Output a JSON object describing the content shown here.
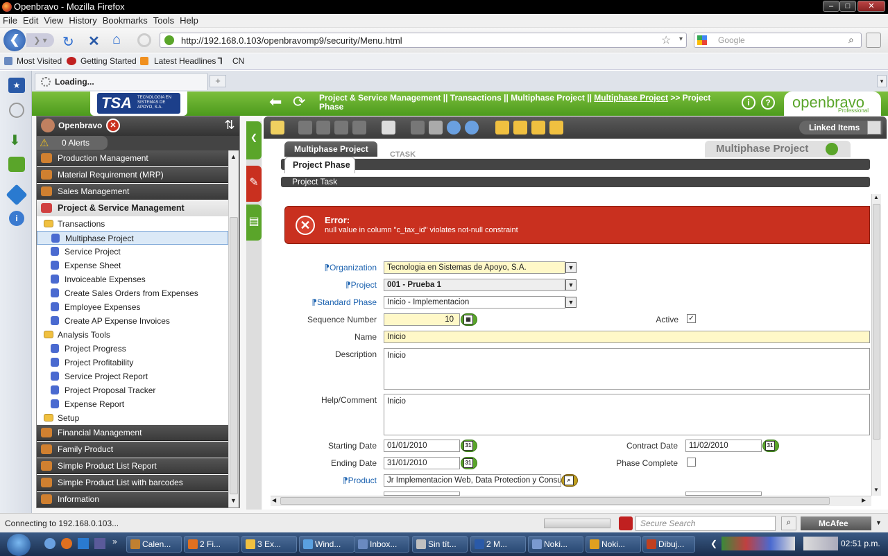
{
  "window": {
    "title": "Openbravo - Mozilla Firefox"
  },
  "menubar": [
    "File",
    "Edit",
    "View",
    "History",
    "Bookmarks",
    "Tools",
    "Help"
  ],
  "nav": {
    "url": "http://192.168.0.103/openbravomp9/security/Menu.html",
    "search_placeholder": "Google"
  },
  "bookmarks": [
    "Most Visited",
    "Getting Started",
    "Latest Headlines",
    "CN"
  ],
  "tab": {
    "label": "Loading..."
  },
  "app": {
    "breadcrumb_line1": "Project & Service Management || Transactions || Multiphase Project ||",
    "breadcrumb_link": "Multiphase Project",
    "breadcrumb_tail": ">> Project",
    "breadcrumb_line2": "Phase",
    "brand": "openbravo",
    "brand_sub": "Professional",
    "tsa": "TSA",
    "tsa_sub": "TECNOLOGIA EN SISTEMAS DE APOYO, S.A."
  },
  "menu": {
    "user": "Openbravo",
    "alerts": "0 Alerts",
    "items": [
      {
        "label": "Production Management",
        "kind": "dark"
      },
      {
        "label": "Material Requirement (MRP)",
        "kind": "dark"
      },
      {
        "label": "Sales Management",
        "kind": "dark"
      },
      {
        "label": "Project & Service Management",
        "kind": "expanded"
      },
      {
        "label": "Transactions",
        "kind": "sub"
      },
      {
        "label": "Multiphase Project",
        "kind": "leaf",
        "selected": true
      },
      {
        "label": "Service Project",
        "kind": "leaf"
      },
      {
        "label": "Expense Sheet",
        "kind": "leaf"
      },
      {
        "label": "Invoiceable Expenses",
        "kind": "leaf"
      },
      {
        "label": "Create Sales Orders from Expenses",
        "kind": "leaf"
      },
      {
        "label": "Employee Expenses",
        "kind": "leaf"
      },
      {
        "label": "Create AP Expense Invoices",
        "kind": "leaf"
      },
      {
        "label": "Analysis Tools",
        "kind": "sub"
      },
      {
        "label": "Project Progress",
        "kind": "leaf"
      },
      {
        "label": "Project Profitability",
        "kind": "leaf"
      },
      {
        "label": "Service Project Report",
        "kind": "leaf"
      },
      {
        "label": "Project Proposal Tracker",
        "kind": "leaf"
      },
      {
        "label": "Expense Report",
        "kind": "leaf"
      },
      {
        "label": "Setup",
        "kind": "sub"
      },
      {
        "label": "Financial Management",
        "kind": "dark"
      },
      {
        "label": "Family Product",
        "kind": "dark"
      },
      {
        "label": "Simple Product List Report",
        "kind": "dark"
      },
      {
        "label": "Simple Product List with barcodes",
        "kind": "dark"
      },
      {
        "label": "Information",
        "kind": "dark"
      }
    ]
  },
  "toolbar": {
    "linked_items": "Linked Items"
  },
  "tabs": {
    "window_title": "Multiphase Project",
    "parent_tab": "Multiphase Project",
    "current_tab": "Project Phase",
    "hidden_tab": "CTASK",
    "child_tab": "Project Task"
  },
  "error": {
    "title": "Error:",
    "message": "null value in column \"c_tax_id\" violates not-null constraint"
  },
  "form": {
    "organization": {
      "label": "Organization",
      "value": "Tecnologia en Sistemas de Apoyo, S.A."
    },
    "project": {
      "label": "Project",
      "value": "001 - Prueba 1"
    },
    "standard_phase": {
      "label": "Standard Phase",
      "value": "Inicio - Implementacion"
    },
    "sequence": {
      "label": "Sequence Number",
      "value": "10"
    },
    "active": {
      "label": "Active",
      "checked": true
    },
    "name": {
      "label": "Name",
      "value": "Inicio"
    },
    "description": {
      "label": "Description",
      "value": "Inicio"
    },
    "help": {
      "label": "Help/Comment",
      "value": "Inicio"
    },
    "starting_date": {
      "label": "Starting Date",
      "value": "01/01/2010"
    },
    "contract_date": {
      "label": "Contract Date",
      "value": "11/02/2010"
    },
    "ending_date": {
      "label": "Ending Date",
      "value": "31/01/2010"
    },
    "phase_complete": {
      "label": "Phase Complete",
      "checked": false
    },
    "product": {
      "label": "Product",
      "value": "Jr Implementacion Web, Data Protection y Consulto"
    },
    "calendar_glyph": "31"
  },
  "statusbar": {
    "text": "Connecting to 192.168.0.103...",
    "secure_search": "Secure Search",
    "mcafee": "McAfee"
  },
  "taskbar": {
    "items": [
      "Calen...",
      "2 Fi...",
      "3 Ex...",
      "Wind...",
      "Inbox...",
      "Sin tít...",
      "2 M...",
      "Noki...",
      "Noki...",
      "Dibuj..."
    ],
    "clock": "02:51 p.m."
  }
}
